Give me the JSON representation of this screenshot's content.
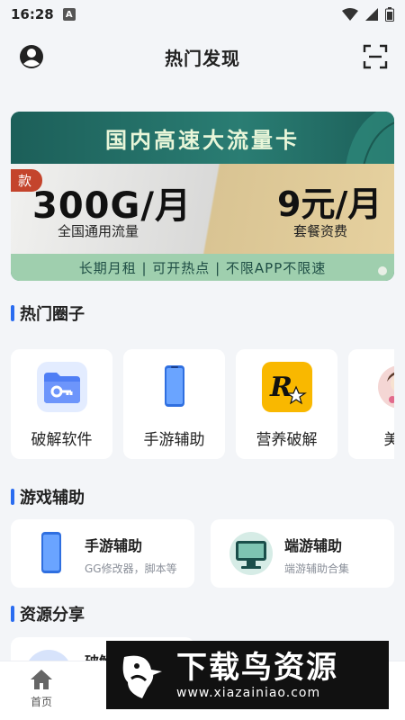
{
  "status_bar": {
    "time": "16:28",
    "notif_glyph": "A",
    "icons": [
      "wifi-icon",
      "signal-icon",
      "battery-icon"
    ]
  },
  "header": {
    "title": "热门发现",
    "left_icon": "user-icon",
    "right_icon": "scan-icon"
  },
  "banner": {
    "headline": "国内高速大流量卡",
    "tag": "款",
    "data_amount": "300G/月",
    "data_sub": "全国通用流量",
    "price": "9元/月",
    "price_sub": "套餐资费",
    "footer": "长期月租 | 可开热点 | 不限APP不限速"
  },
  "sections": {
    "hot_circles": "热门圈子",
    "game_helper": "游戏辅助",
    "resources": "资源分享"
  },
  "circles": [
    {
      "label": "破解软件",
      "icon": "folder-key-icon"
    },
    {
      "label": "手游辅助",
      "icon": "phone-icon"
    },
    {
      "label": "营养破解",
      "icon": "rockstar-icon"
    },
    {
      "label": "美女",
      "icon": "avatar-icon"
    }
  ],
  "game_cards": [
    {
      "title": "手游辅助",
      "subtitle": "GG修改器，脚本等",
      "icon": "phone-icon"
    },
    {
      "title": "端游辅助",
      "subtitle": "端游辅助合集",
      "icon": "monitor-icon"
    }
  ],
  "resources_peek": {
    "partial_title": "破解"
  },
  "bottom_nav": {
    "home_label": "首页"
  },
  "watermark": {
    "cn": "下载鸟资源",
    "url": "www.xiazainiao.com"
  },
  "colors": {
    "accent": "#2a6cf0",
    "banner_green": "#1d6a63",
    "background": "#f3f5f8"
  }
}
